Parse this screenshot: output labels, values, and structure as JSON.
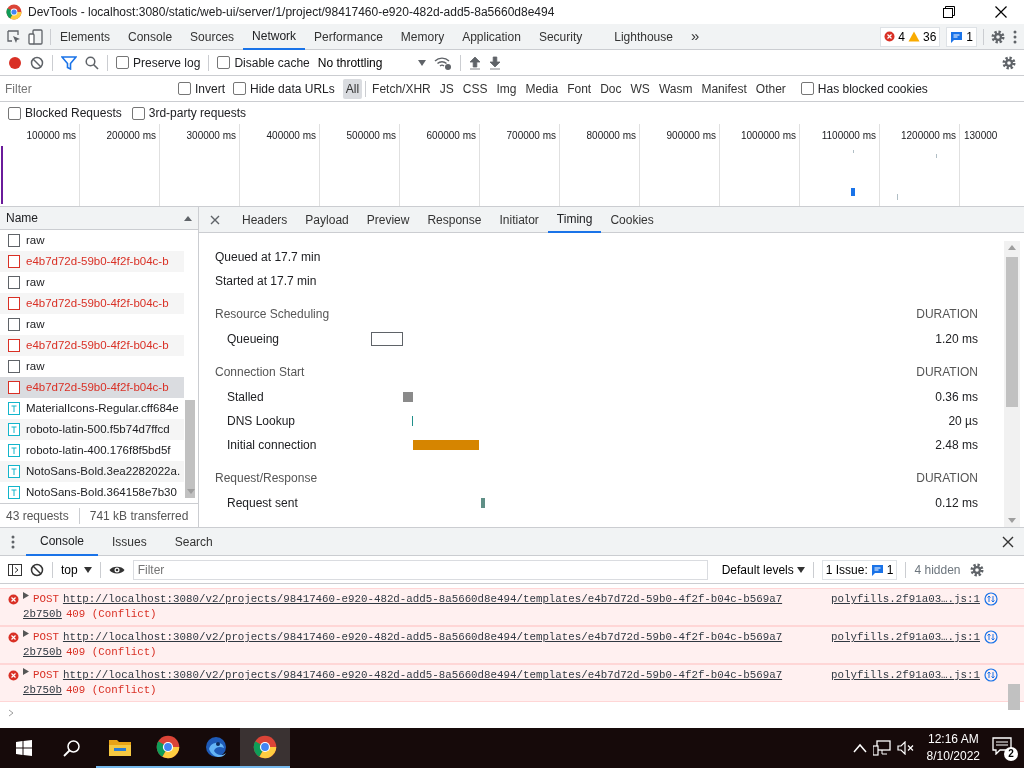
{
  "window": {
    "title": "DevTools - localhost:3080/static/web-ui/server/1/project/98417460-e920-482d-add5-8a5660d8e494"
  },
  "devtools_tabs": [
    {
      "label": "Elements",
      "selected": false
    },
    {
      "label": "Console",
      "selected": false
    },
    {
      "label": "Sources",
      "selected": false
    },
    {
      "label": "Network",
      "selected": true
    },
    {
      "label": "Performance",
      "selected": false
    },
    {
      "label": "Memory",
      "selected": false
    },
    {
      "label": "Application",
      "selected": false
    },
    {
      "label": "Security",
      "selected": false
    },
    {
      "label": "Lighthouse",
      "selected": false
    }
  ],
  "more_tabs": "»",
  "counters": {
    "errors": "4",
    "warnings": "36",
    "issues": "1"
  },
  "network_toolbar": {
    "recording": true,
    "preserve_log": {
      "label": "Preserve log",
      "checked": false
    },
    "disable_cache": {
      "label": "Disable cache",
      "checked": false
    },
    "throttling": "No throttling"
  },
  "filter_bar": {
    "placeholder": "Filter",
    "invert": {
      "label": "Invert",
      "checked": false
    },
    "hide_data_urls": {
      "label": "Hide data URLs",
      "checked": false
    },
    "types": [
      {
        "label": "All",
        "selected": true
      },
      {
        "label": "Fetch/XHR",
        "selected": false
      },
      {
        "label": "JS",
        "selected": false
      },
      {
        "label": "CSS",
        "selected": false
      },
      {
        "label": "Img",
        "selected": false
      },
      {
        "label": "Media",
        "selected": false
      },
      {
        "label": "Font",
        "selected": false
      },
      {
        "label": "Doc",
        "selected": false
      },
      {
        "label": "WS",
        "selected": false
      },
      {
        "label": "Wasm",
        "selected": false
      },
      {
        "label": "Manifest",
        "selected": false
      },
      {
        "label": "Other",
        "selected": false
      }
    ],
    "has_blocked_cookies": {
      "label": "Has blocked cookies",
      "checked": false
    },
    "blocked_requests": {
      "label": "Blocked Requests",
      "checked": false
    },
    "third_party": {
      "label": "3rd-party requests",
      "checked": false
    }
  },
  "overview": {
    "ticks": [
      "100000 ms",
      "200000 ms",
      "300000 ms",
      "400000 ms",
      "500000 ms",
      "600000 ms",
      "700000 ms",
      "800000 ms",
      "900000 ms",
      "1000000 ms",
      "1100000 ms",
      "1200000 ms",
      "130000"
    ]
  },
  "requests": {
    "column": "Name",
    "rows": [
      {
        "name": "raw",
        "kind": "doc",
        "failed": false,
        "selected": false
      },
      {
        "name": "e4b7d72d-59b0-4f2f-b04c-b",
        "kind": "doc",
        "failed": true,
        "selected": false
      },
      {
        "name": "raw",
        "kind": "doc",
        "failed": false,
        "selected": false
      },
      {
        "name": "e4b7d72d-59b0-4f2f-b04c-b",
        "kind": "doc",
        "failed": true,
        "selected": false
      },
      {
        "name": "raw",
        "kind": "doc",
        "failed": false,
        "selected": false
      },
      {
        "name": "e4b7d72d-59b0-4f2f-b04c-b",
        "kind": "doc",
        "failed": true,
        "selected": false
      },
      {
        "name": "raw",
        "kind": "doc",
        "failed": false,
        "selected": false
      },
      {
        "name": "e4b7d72d-59b0-4f2f-b04c-b",
        "kind": "doc",
        "failed": true,
        "selected": true
      },
      {
        "name": "MaterialIcons-Regular.cff684e",
        "kind": "font",
        "failed": false,
        "selected": false
      },
      {
        "name": "roboto-latin-500.f5b74d7ffcd",
        "kind": "font",
        "failed": false,
        "selected": false
      },
      {
        "name": "roboto-latin-400.176f8f5bd5f",
        "kind": "font",
        "failed": false,
        "selected": false
      },
      {
        "name": "NotoSans-Bold.3ea2282022a.",
        "kind": "font",
        "failed": false,
        "selected": false
      },
      {
        "name": "NotoSans-Bold.364158e7b30",
        "kind": "font",
        "failed": false,
        "selected": false
      }
    ],
    "summary": [
      "43 requests",
      "741 kB transferred"
    ]
  },
  "detail_tabs": [
    {
      "label": "Headers",
      "selected": false
    },
    {
      "label": "Payload",
      "selected": false
    },
    {
      "label": "Preview",
      "selected": false
    },
    {
      "label": "Response",
      "selected": false
    },
    {
      "label": "Initiator",
      "selected": false
    },
    {
      "label": "Timing",
      "selected": true
    },
    {
      "label": "Cookies",
      "selected": false
    }
  ],
  "timing": {
    "queued": "Queued at 17.7 min",
    "started": "Started at 17.7 min",
    "sections": [
      {
        "title": "Resource Scheduling",
        "column": "DURATION",
        "phases": [
          {
            "label": "Queueing",
            "kind": "queueing",
            "duration": "1.20 ms"
          }
        ]
      },
      {
        "title": "Connection Start",
        "column": "DURATION",
        "phases": [
          {
            "label": "Stalled",
            "kind": "stalled",
            "duration": "0.36 ms"
          },
          {
            "label": "DNS Lookup",
            "kind": "dns",
            "duration": "20 µs"
          },
          {
            "label": "Initial connection",
            "kind": "connection",
            "duration": "2.48 ms"
          }
        ]
      },
      {
        "title": "Request/Response",
        "column": "DURATION",
        "phases": [
          {
            "label": "Request sent",
            "kind": "sent",
            "duration": "0.12 ms"
          }
        ]
      }
    ]
  },
  "drawer": {
    "tabs": [
      {
        "label": "Console",
        "selected": true
      },
      {
        "label": "Issues",
        "selected": false
      },
      {
        "label": "Search",
        "selected": false
      }
    ],
    "context": "top",
    "filter_placeholder": "Filter",
    "levels": "Default levels",
    "issues_label": "1 Issue:",
    "issues_count": "1",
    "hidden": "4 hidden",
    "messages": [
      {
        "method": "POST",
        "url_lines": [
          "http://localhost:3080/v2/projects/98417460-e920-482d-add5-8a5660d8e494/templates/e4b7d72d-59b0-4f2f-b04c-b569a7",
          "2b750b"
        ],
        "status": "409 (Conflict)",
        "source": "polyfills.2f91a03….js:1"
      },
      {
        "method": "POST",
        "url_lines": [
          "http://localhost:3080/v2/projects/98417460-e920-482d-add5-8a5660d8e494/templates/e4b7d72d-59b0-4f2f-b04c-b569a7",
          "2b750b"
        ],
        "status": "409 (Conflict)",
        "source": "polyfills.2f91a03….js:1"
      },
      {
        "method": "POST",
        "url_lines": [
          "http://localhost:3080/v2/projects/98417460-e920-482d-add5-8a5660d8e494/templates/e4b7d72d-59b0-4f2f-b04c-b569a7",
          "2b750b"
        ],
        "status": "409 (Conflict)",
        "source": "polyfills.2f91a03….js:1"
      }
    ]
  },
  "taskbar": {
    "time": "12:16 AM",
    "date": "8/10/2022",
    "notifications": "2"
  }
}
